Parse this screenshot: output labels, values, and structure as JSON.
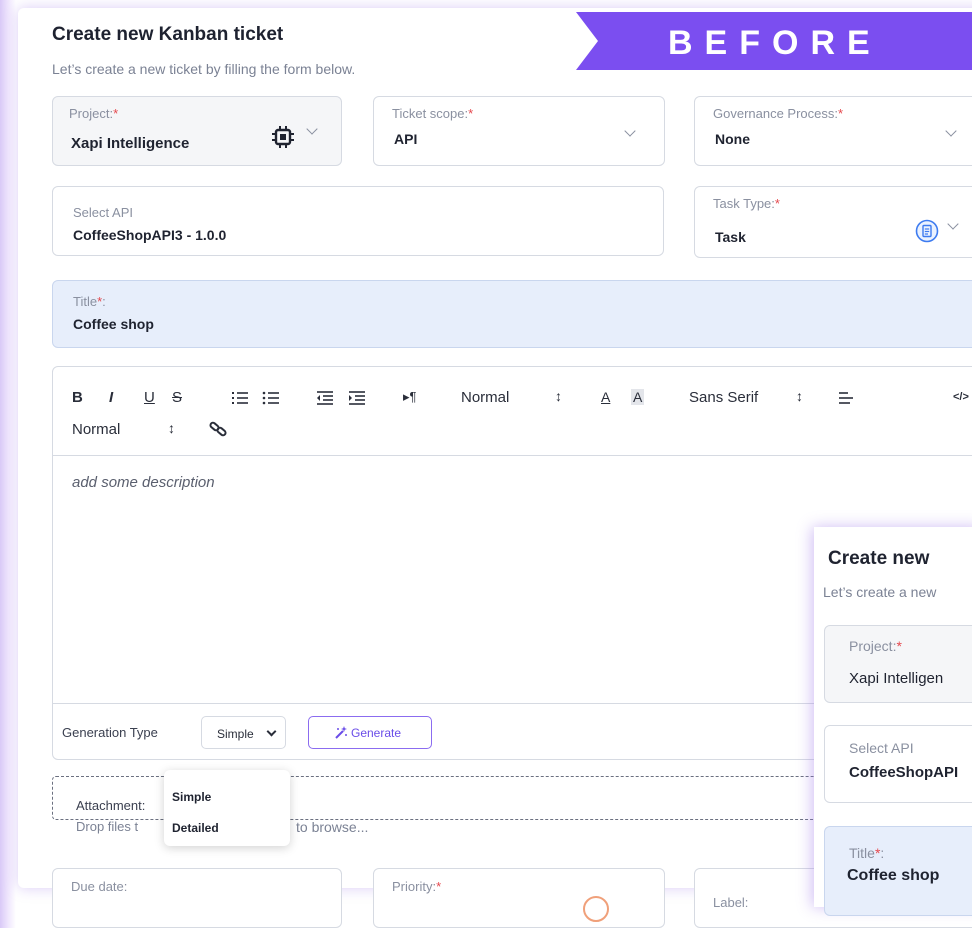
{
  "banner": "BEFORE",
  "header": {
    "title": "Create new Kanban ticket",
    "subtitle": "Let’s create a new ticket by filling the form below."
  },
  "project": {
    "label": "Project:",
    "required": "*",
    "value": "Xapi Intelligence",
    "icon": "chip-icon"
  },
  "ticket_scope": {
    "label": "Ticket scope:",
    "required": "*",
    "value": "API"
  },
  "governance": {
    "label": "Governance Process:",
    "required": "*",
    "value": "None"
  },
  "select_api": {
    "label": "Select API",
    "value": "CoffeeShopAPI3 - 1.0.0"
  },
  "task_type": {
    "label": "Task Type:",
    "required": "*",
    "value": "Task",
    "icon": "document-icon"
  },
  "title_field": {
    "label": "Title",
    "required": "*",
    "colon": ":",
    "value": "Coffee shop"
  },
  "editor": {
    "toolbar": {
      "bold": "B",
      "italic": "I",
      "underline": "U",
      "strike": "S",
      "pilcrow": "¶",
      "heading": "Normal",
      "sort": "↕",
      "color_a": "A",
      "bg_a": "A",
      "font": "Sans Serif",
      "size": "Normal",
      "code": "</>"
    },
    "placeholder": "add some description"
  },
  "generation": {
    "label": "Generation Type",
    "selected": "Simple",
    "button": "Generate",
    "options": [
      "Simple",
      "Detailed"
    ]
  },
  "attachment": {
    "label": "Attachment:",
    "hint_start": "Drop files t",
    "hint_end": "to browse..."
  },
  "due_date": {
    "label": "Due date:"
  },
  "priority": {
    "label": "Priority:",
    "required": "*"
  },
  "label_field": {
    "label": "Label:"
  },
  "overlay": {
    "title": "Create new",
    "subtitle": "Let’s create a new",
    "project_label": "Project:",
    "project_value": "Xapi Intelligen",
    "select_api_label": "Select API",
    "select_api_value": "CoffeeShopAPI",
    "title_label": "Title",
    "title_value": "Coffee shop"
  },
  "colors": {
    "accent": "#7b4ef0",
    "title_bg": "#e7eefb",
    "required": "#e5484d"
  }
}
